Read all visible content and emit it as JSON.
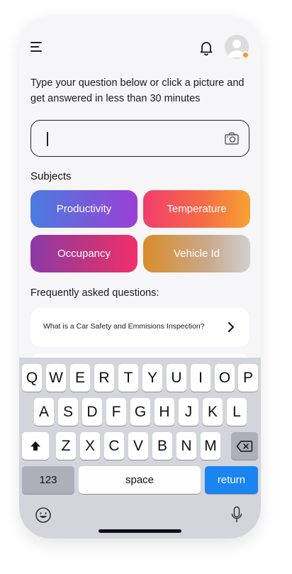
{
  "header": {
    "menu_icon": "hamburger-menu-icon",
    "notification_icon": "bell-icon",
    "avatar_icon": "user-avatar-icon",
    "avatar_badge_color": "#f59a2f"
  },
  "prompt": {
    "text": "Type your question below or click a picture and get answered in less than 30 minutes"
  },
  "question_input": {
    "value": "",
    "camera_icon": "camera-icon"
  },
  "subjects": {
    "title": "Subjects",
    "items": [
      {
        "label": "Productivity"
      },
      {
        "label": "Temperature"
      },
      {
        "label": "Occupancy"
      },
      {
        "label": "Vehicle Id"
      }
    ]
  },
  "faq": {
    "title": "Frequently asked questions:",
    "items": [
      {
        "question": "What is a Car Safety and Emmisions Inspection?"
      }
    ]
  },
  "keyboard": {
    "row1": [
      "Q",
      "W",
      "E",
      "R",
      "T",
      "Y",
      "U",
      "I",
      "O",
      "P"
    ],
    "row2": [
      "A",
      "S",
      "D",
      "F",
      "G",
      "H",
      "J",
      "K",
      "L"
    ],
    "row3": [
      "Z",
      "X",
      "C",
      "V",
      "B",
      "N",
      "M"
    ],
    "numbers_label": "123",
    "space_label": "space",
    "return_label": "return",
    "return_color": "#1a84f1"
  }
}
